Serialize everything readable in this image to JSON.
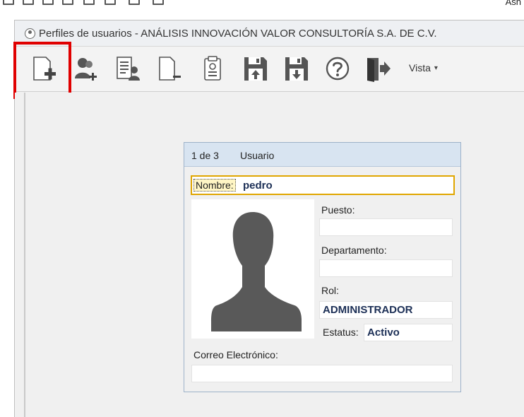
{
  "top_strip": {
    "clipped_text": "Asn"
  },
  "window": {
    "title": "Perfiles de usuarios - ANÁLISIS INNOVACIÓN VALOR CONSULTORÍA S.A. DE C.V."
  },
  "toolbar": {
    "vista_label": "Vista",
    "vista_caret": "▾",
    "buttons": [
      "new-document",
      "add-user",
      "user-list",
      "remove-document",
      "clipboard",
      "save-upload",
      "save-download",
      "help",
      "exit"
    ]
  },
  "card": {
    "counter": "1 de 3",
    "caption": "Usuario",
    "name_label": "Nombre:",
    "name_value": "pedro",
    "puesto_label": "Puesto:",
    "puesto_value": "",
    "departamento_label": "Departamento:",
    "departamento_value": "",
    "rol_label": "Rol:",
    "rol_value": "ADMINISTRADOR",
    "estatus_label": "Estatus:",
    "estatus_value": "Activo",
    "correo_label": "Correo Electrónico:",
    "correo_value": ""
  },
  "colors": {
    "highlight": "#e00000",
    "card_header": "#d8e4f1",
    "name_border": "#e0a600",
    "value_text": "#1c2f56"
  }
}
